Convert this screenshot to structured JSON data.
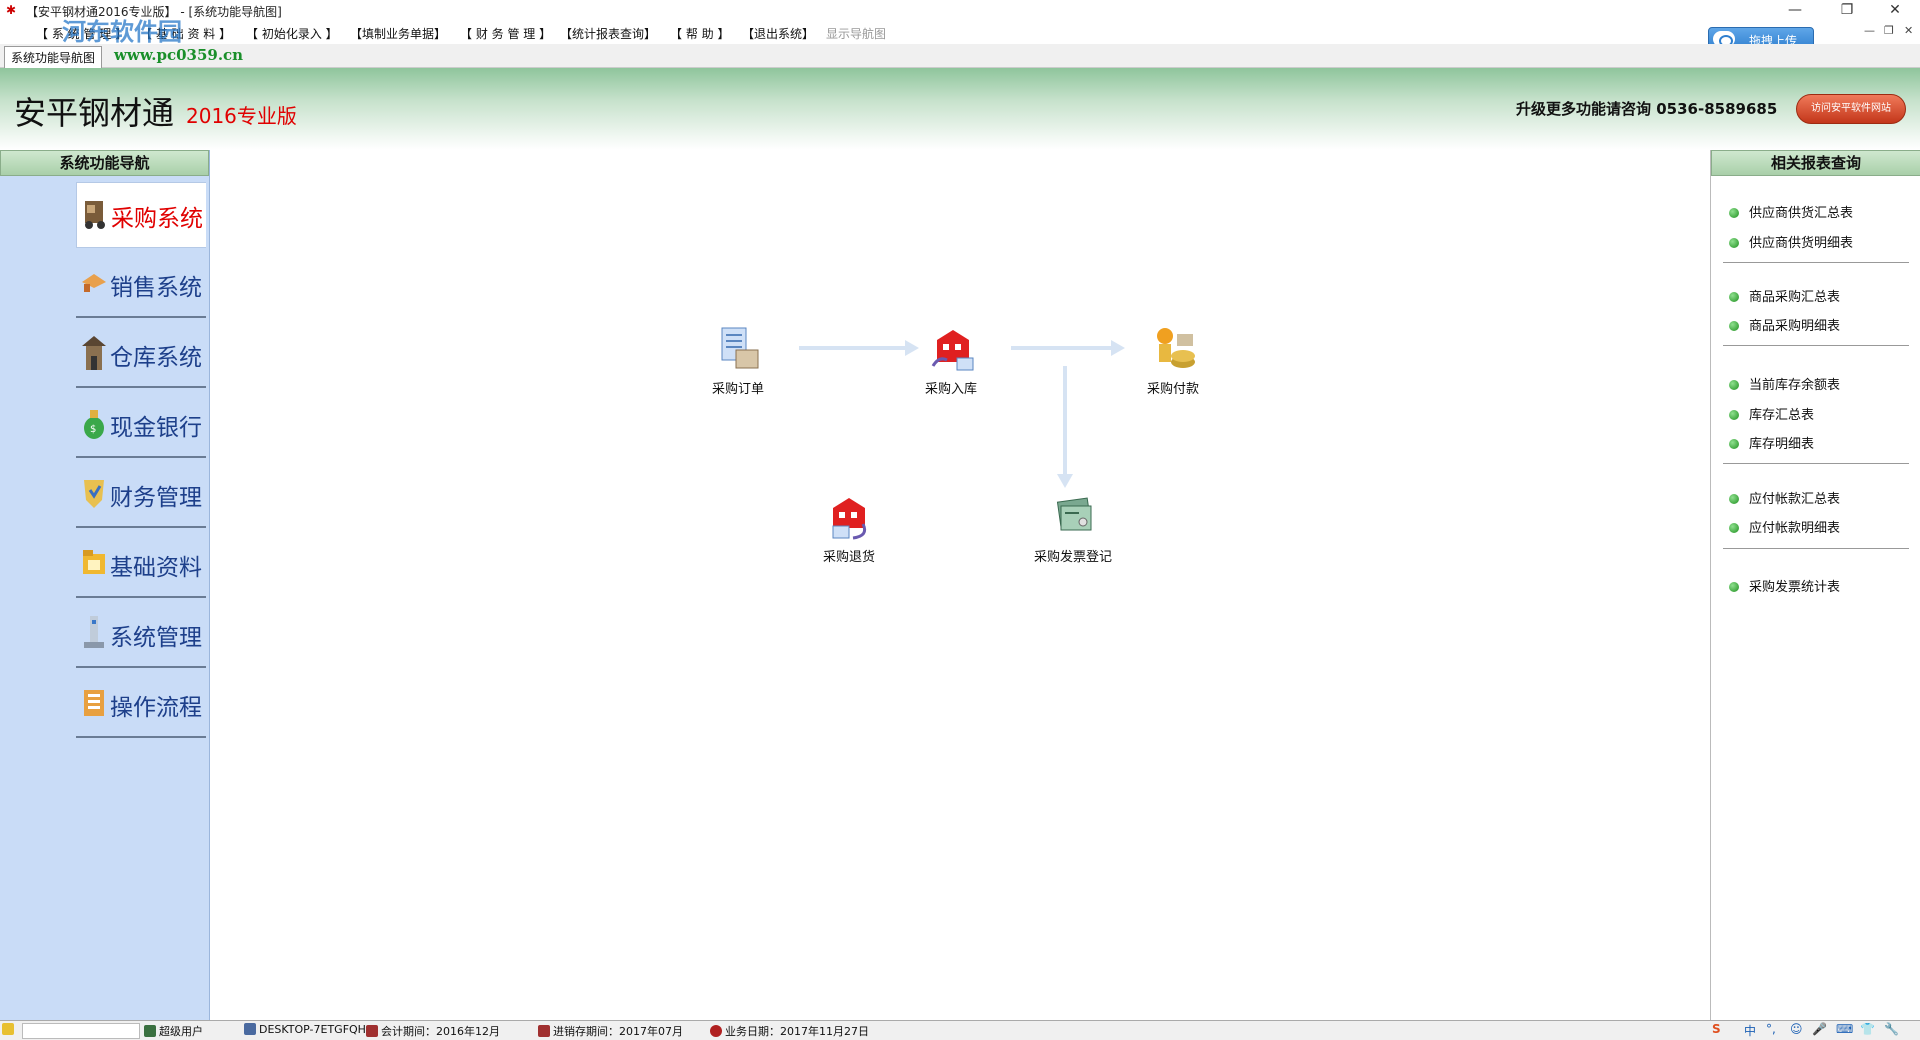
{
  "window": {
    "title": "【安平钢材通2016专业版】 - [系统功能导航图]",
    "controls": [
      "—",
      "❐",
      "✕"
    ]
  },
  "menu": {
    "items": [
      "【 系 统 管 理 】",
      "【 基 础 资 料 】",
      "【 初始化录入 】",
      "【填制业务单据】",
      "【 财 务 管 理 】",
      "【统计报表查询】",
      "【 帮 助 】",
      "【退出系统】"
    ],
    "disabled_item": "显示导航图",
    "upload_label": "拖拽上传",
    "mdi_controls": [
      "—",
      "❐",
      "✕"
    ]
  },
  "tabs": {
    "active": "系统功能导航图"
  },
  "watermark": {
    "line1": "河东软件园",
    "line2": "www.pc0359.cn"
  },
  "banner": {
    "app_name": "安平钢材通",
    "edition": "2016专业版",
    "upgrade_text": "升级更多功能请咨询 0536-8589685",
    "visit_button": "访问安平软件网站"
  },
  "left_nav": {
    "header": "系统功能导航",
    "items": [
      {
        "label": "采购系统",
        "icon": "truck-icon"
      },
      {
        "label": "销售系统",
        "icon": "handshake-icon"
      },
      {
        "label": "仓库系统",
        "icon": "warehouse-icon"
      },
      {
        "label": "现金银行",
        "icon": "money-bag-icon"
      },
      {
        "label": "财务管理",
        "icon": "finance-shield-icon"
      },
      {
        "label": "基础资料",
        "icon": "folder-icon"
      },
      {
        "label": "系统管理",
        "icon": "computer-icon"
      },
      {
        "label": "操作流程",
        "icon": "flowchart-icon"
      }
    ]
  },
  "flow": {
    "nodes": [
      "采购订单",
      "采购入库",
      "采购付款",
      "采购退货",
      "采购发票登记"
    ]
  },
  "right_nav": {
    "header": "相关报表查询",
    "links": [
      "供应商供货汇总表",
      "供应商供货明细表",
      "商品采购汇总表",
      "商品采购明细表",
      "当前库存余额表",
      "库存汇总表",
      "库存明细表",
      "应付帐款汇总表",
      "应付帐款明细表",
      "采购发票统计表"
    ]
  },
  "status": {
    "user": "超级用户",
    "computer": "DESKTOP-7ETGFQH",
    "accounting_period": "会计期间：2016年12月",
    "inventory_period": "进销存期间：2017年07月",
    "business_date": "业务日期：2017年11月27日",
    "ime": [
      "S",
      "中",
      "°,",
      "☺",
      "🎤",
      "⌨",
      "👕",
      "🔧"
    ]
  }
}
